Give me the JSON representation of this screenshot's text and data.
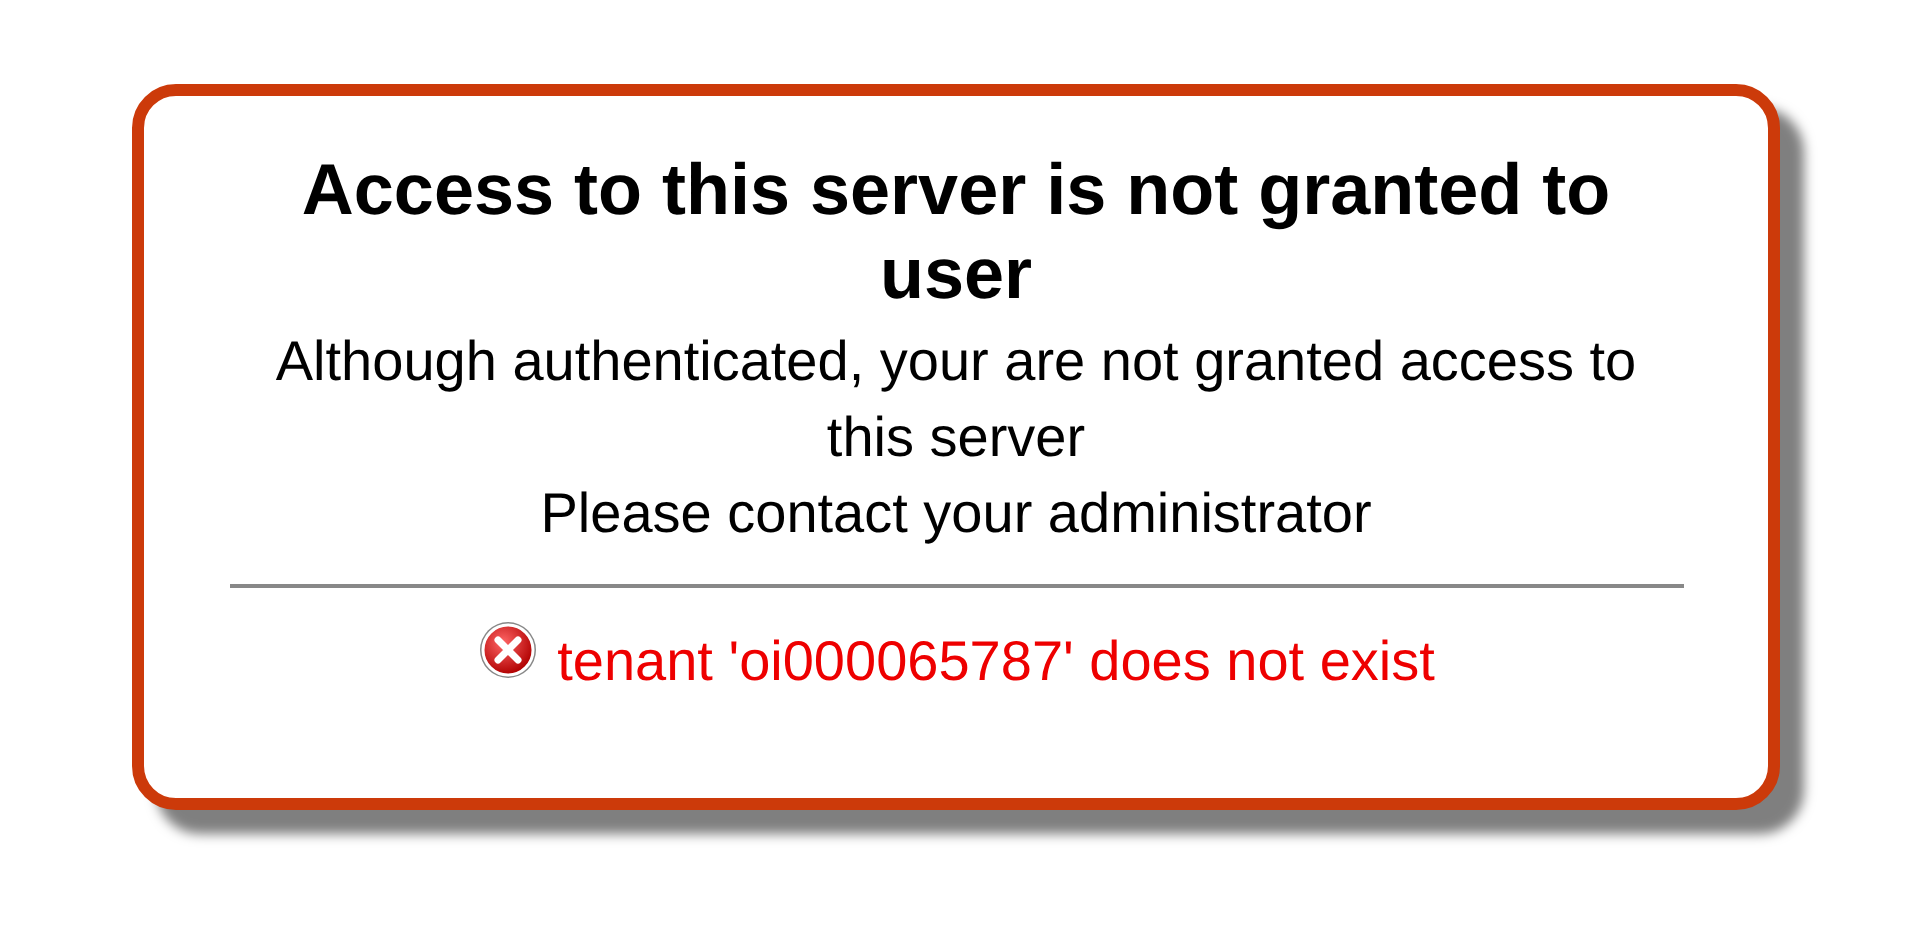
{
  "title": "Access to this server is not granted to user",
  "message": [
    "Although authenticated, your are not granted access to this server",
    "Please contact your administrator"
  ],
  "error": "tenant 'oi000065787' does not exist"
}
